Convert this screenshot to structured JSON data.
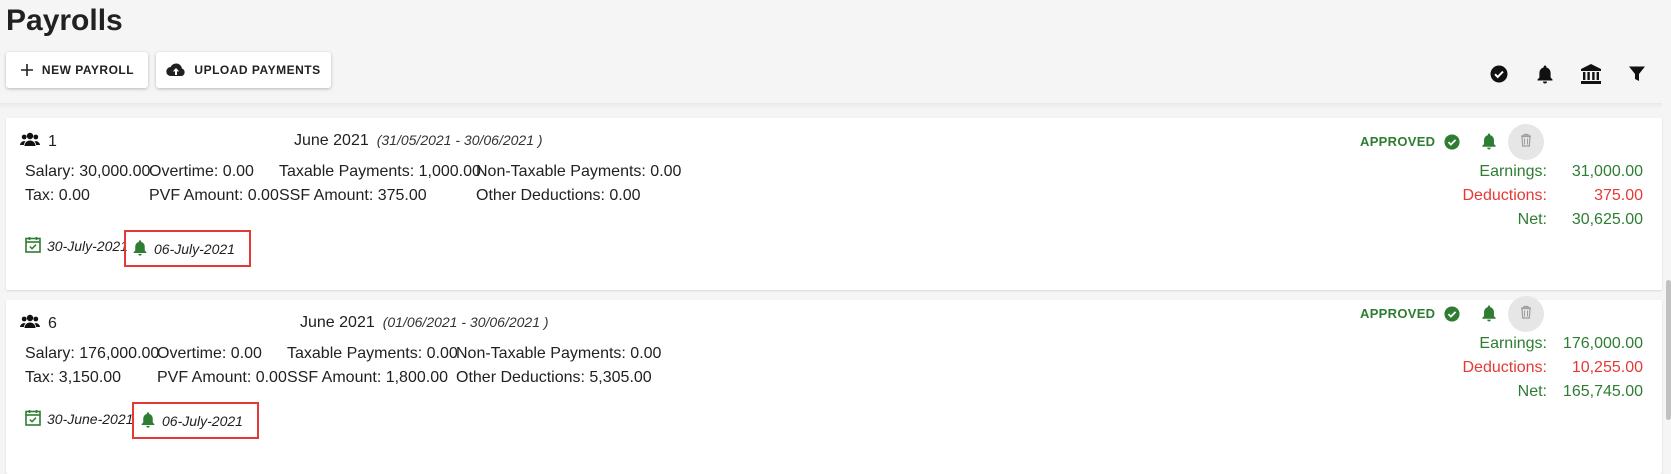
{
  "page": {
    "title": "Payrolls"
  },
  "toolbar": {
    "new_payroll_label": "NEW PAYROLL",
    "upload_payments_label": "UPLOAD PAYMENTS",
    "icons": [
      "check-circle-icon",
      "bell-icon",
      "bank-icon",
      "filter-icon"
    ]
  },
  "colors": {
    "approved": "#2e7d32",
    "deductions": "#e53935",
    "highlight": "#e53935"
  },
  "payrolls": [
    {
      "employee_count": "1",
      "month": "June 2021",
      "range": "(31/05/2021 - 30/06/2021 )",
      "salary": "Salary: 30,000.00",
      "overtime": "Overtime: 0.00",
      "taxable": "Taxable Payments: 1,000.00",
      "non_taxable": "Non-Taxable Payments: 0.00",
      "tax": "Tax: 0.00",
      "pvf": "PVF Amount: 0.00",
      "ssf": "SSF Amount: 375.00",
      "other_deductions": "Other Deductions: 0.00",
      "pay_date": "30-July-2021",
      "reminder_date": "06-July-2021",
      "status": "APPROVED",
      "earnings_label": "Earnings:",
      "earnings": "31,000.00",
      "deductions_label": "Deductions:",
      "deductions": "375.00",
      "net_label": "Net:",
      "net": "30,625.00"
    },
    {
      "employee_count": "6",
      "month": "June 2021",
      "range": "(01/06/2021 - 30/06/2021 )",
      "salary": "Salary: 176,000.00",
      "overtime": "Overtime: 0.00",
      "taxable": "Taxable Payments: 0.00",
      "non_taxable": "Non-Taxable Payments: 0.00",
      "tax": "Tax: 3,150.00",
      "pvf": "PVF Amount: 0.00",
      "ssf": "SSF Amount: 1,800.00",
      "other_deductions": "Other Deductions: 5,305.00",
      "pay_date": "30-June-2021",
      "reminder_date": "06-July-2021",
      "status": "APPROVED",
      "earnings_label": "Earnings:",
      "earnings": "176,000.00",
      "deductions_label": "Deductions:",
      "deductions": "10,255.00",
      "net_label": "Net:",
      "net": "165,745.00"
    }
  ]
}
